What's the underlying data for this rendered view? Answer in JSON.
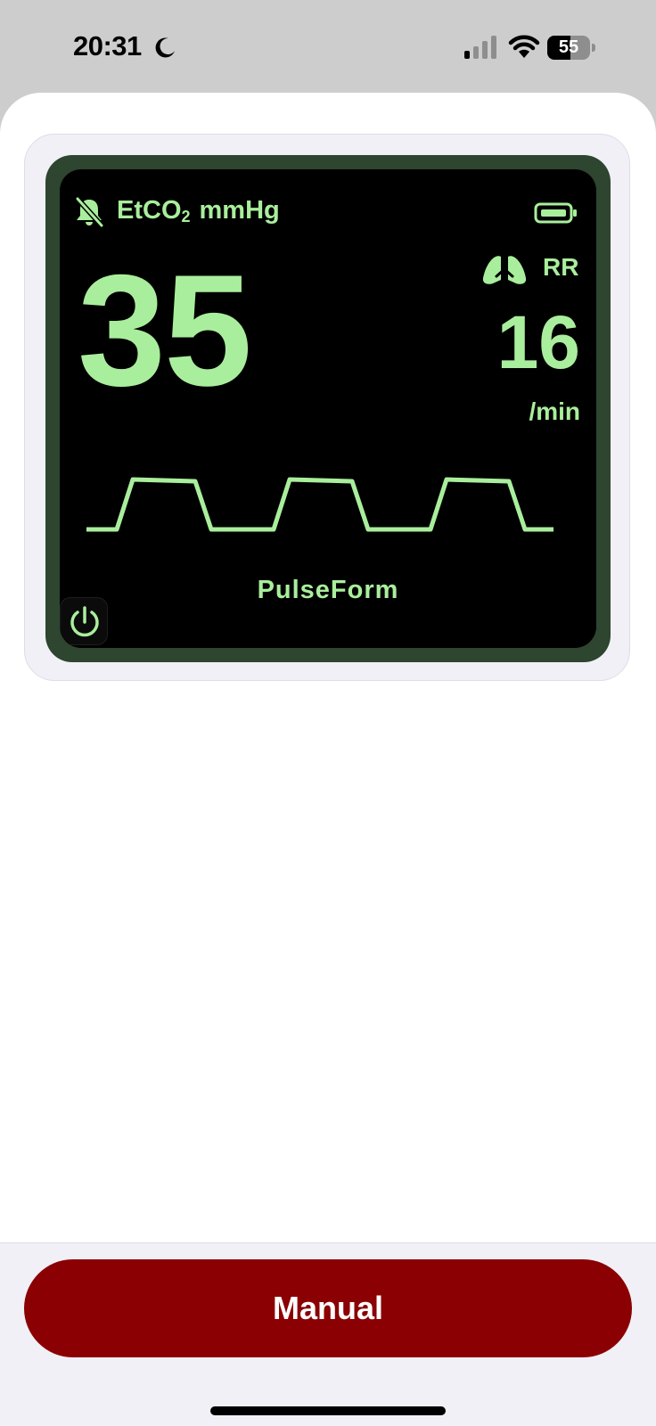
{
  "status_bar": {
    "time": "20:31",
    "battery_level": "55",
    "battery_fraction": 0.55,
    "focus_icon": "moon-icon",
    "signal_bars_active": 1,
    "signal_icon": "cellular-signal-icon",
    "wifi_icon": "wifi-icon"
  },
  "monitor": {
    "parameter": "EtCO",
    "parameter_subscript": "2",
    "unit": "mmHg",
    "etco2_value": "35",
    "rr_label": "RR",
    "rr_value": "16",
    "rr_unit": "/min",
    "device_name": "PulseForm",
    "alarm_icon": "bell-slash-icon",
    "battery_icon": "battery-icon",
    "lungs_icon": "lungs-icon",
    "power_icon": "power-icon",
    "waveform_cycles": 3
  },
  "actions": {
    "manual_label": "Manual"
  },
  "colors": {
    "display_green": "#a9ee9c",
    "bezel": "#2e4530",
    "screen": "#000000",
    "manual_button": "#8a0003"
  }
}
